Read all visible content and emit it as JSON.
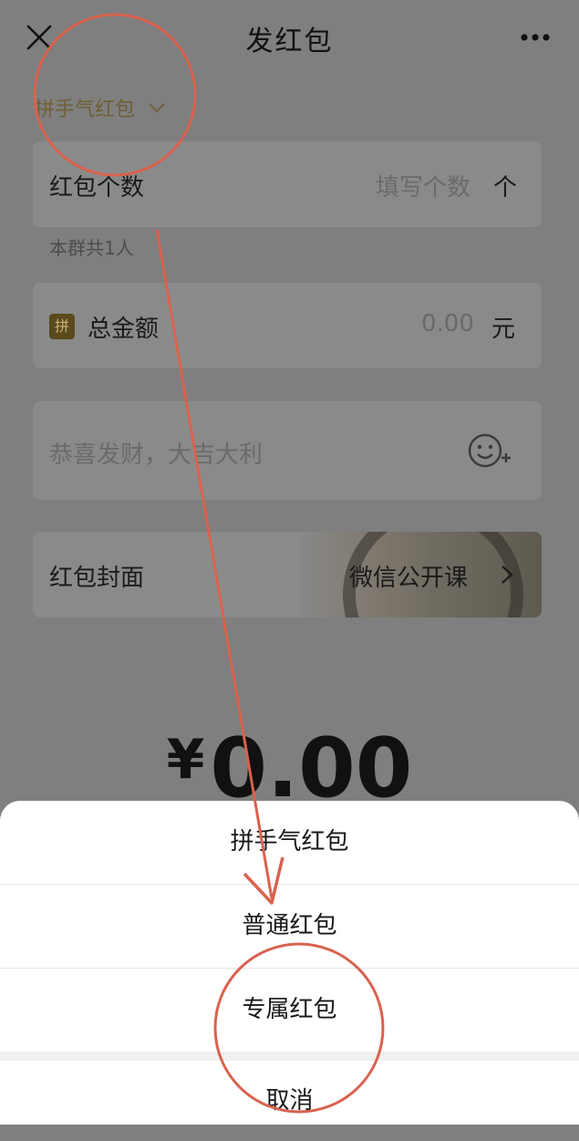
{
  "header": {
    "title": "发红包",
    "close_icon": "close-icon",
    "more_icon": "more-icon"
  },
  "type_selector": {
    "label": "拼手气红包",
    "icon": "chevron-down-icon"
  },
  "count_field": {
    "label": "红包个数",
    "placeholder": "填写个数",
    "unit": "个",
    "hint": "本群共1人"
  },
  "amount_field": {
    "badge": "拼",
    "label": "总金额",
    "value": "0.00",
    "unit": "元"
  },
  "message_field": {
    "placeholder": "恭喜发财，大吉大利",
    "icon": "emoji-add-icon"
  },
  "cover_field": {
    "label": "红包封面",
    "value": "微信公开课",
    "icon": "chevron-right-icon"
  },
  "total": {
    "currency": "¥",
    "amount": "0.00"
  },
  "action_sheet": {
    "options": [
      "拼手气红包",
      "普通红包",
      "专属红包"
    ],
    "cancel": "取消"
  },
  "annotation_color": "#d9624f"
}
